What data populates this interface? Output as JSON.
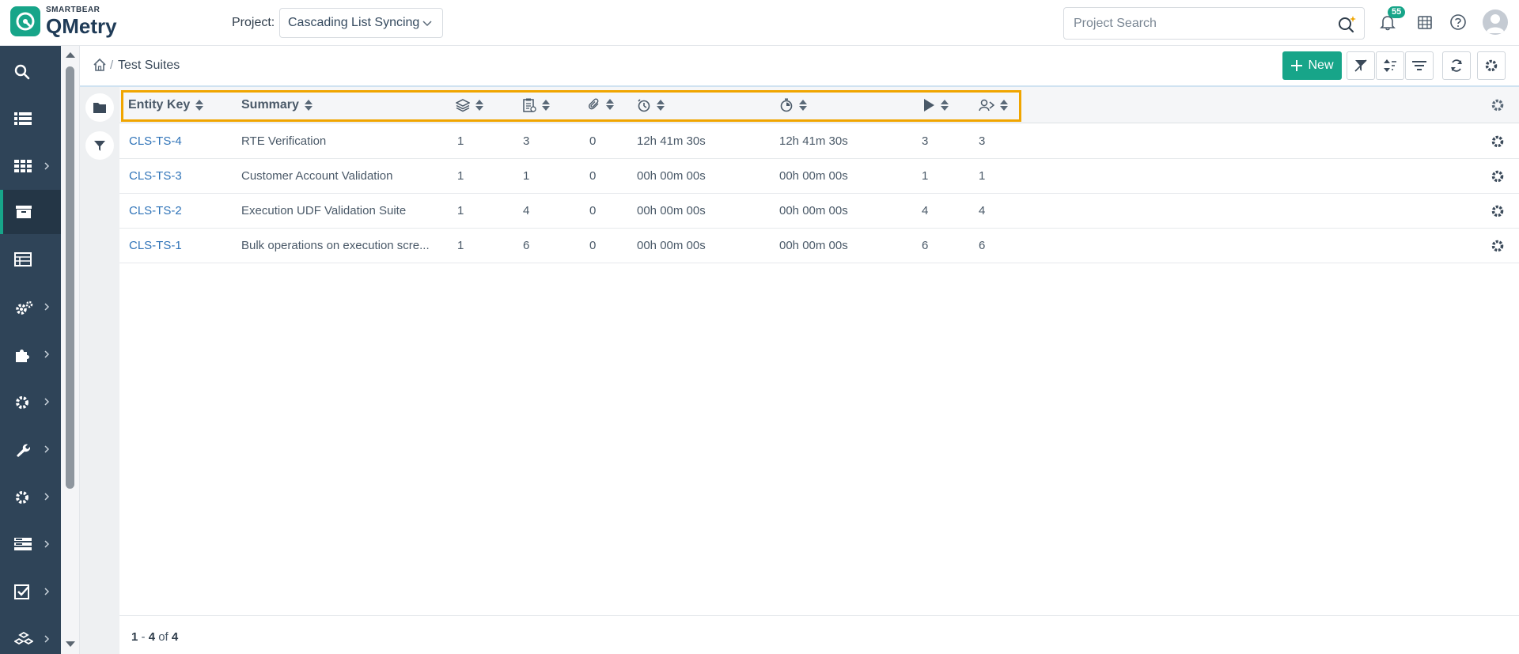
{
  "header": {
    "brand_small": "SMARTBEAR",
    "brand_name": "QMetry",
    "project_label": "Project:",
    "project_value": "Cascading List Syncing",
    "search_placeholder": "Project Search",
    "notification_count": "55"
  },
  "breadcrumb": {
    "separator": "/",
    "current": "Test Suites"
  },
  "toolbar": {
    "new_label": "New"
  },
  "table": {
    "columns": [
      "Entity Key",
      "Summary"
    ],
    "rows": [
      {
        "key": "CLS-TS-4",
        "summary": "RTE Verification",
        "c1": "1",
        "c2": "3",
        "c3": "0",
        "t1": "12h 41m 30s",
        "t2": "12h 41m 30s",
        "c4": "3",
        "c5": "3"
      },
      {
        "key": "CLS-TS-3",
        "summary": "Customer Account Validation",
        "c1": "1",
        "c2": "1",
        "c3": "0",
        "t1": "00h 00m 00s",
        "t2": "00h 00m 00s",
        "c4": "1",
        "c5": "1"
      },
      {
        "key": "CLS-TS-2",
        "summary": "Execution UDF Validation Suite",
        "c1": "1",
        "c2": "4",
        "c3": "0",
        "t1": "00h 00m 00s",
        "t2": "00h 00m 00s",
        "c4": "4",
        "c5": "4"
      },
      {
        "key": "CLS-TS-1",
        "summary": "Bulk operations on execution scre...",
        "c1": "1",
        "c2": "6",
        "c3": "0",
        "t1": "00h 00m 00s",
        "t2": "00h 00m 00s",
        "c4": "6",
        "c5": "6"
      }
    ]
  },
  "pagination": {
    "start": "1",
    "dash": "-",
    "end": "4",
    "of": "of",
    "total": "4"
  },
  "colors": {
    "brand": "#17a589",
    "sidebar": "#2f4458",
    "highlight": "#f0a500",
    "link": "#2f73b8"
  },
  "icons": {
    "sidebar": [
      "search-icon",
      "list-icon",
      "grid-icon",
      "archive-icon",
      "table-icon",
      "gears-icon",
      "puzzle-icon",
      "gear-icon",
      "wrench-icon",
      "settings-icon",
      "server-icon",
      "checkbox-icon",
      "cubes-icon"
    ]
  }
}
